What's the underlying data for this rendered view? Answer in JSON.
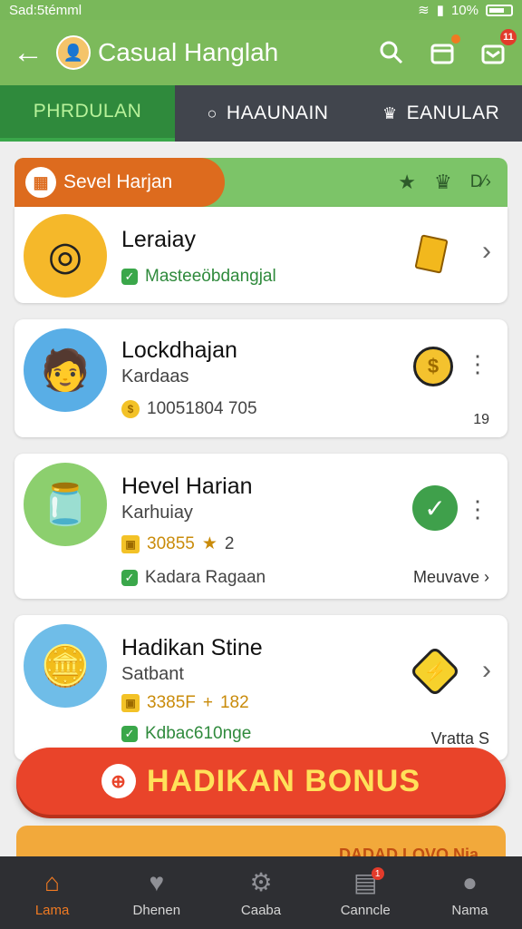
{
  "status_bar": {
    "left": "Sad:5témml",
    "battery": "10%"
  },
  "app_bar": {
    "title": "Casual Hanglah",
    "icons": [
      "back-arrow-icon",
      "search-icon",
      "calendar-icon",
      "gift-icon"
    ],
    "calendar_badge": "",
    "gift_badge": "11"
  },
  "tabs": [
    {
      "label": "PHRDULAN",
      "active": true
    },
    {
      "label": "HAAUNAIN",
      "icon": "search-bubble-icon"
    },
    {
      "label": "EANULAR",
      "icon": "trophy-icon"
    }
  ],
  "section": {
    "title": "Sevel Harjan",
    "more": "D⁄›",
    "colors": {
      "pill": "#dd6b1e",
      "band": "#7cc468"
    }
  },
  "items": [
    {
      "name": "Leraiay",
      "status": "Masteeöbdangjal",
      "thumb_icon": "target-clock-icon",
      "side_icon": "ticket-icon",
      "action": "chevron"
    },
    {
      "name": "Lockdhajan",
      "sub": "Kardaas",
      "coins": "10051804 705",
      "count": "19",
      "thumb_icon": "explorer-avatar-icon",
      "side_icon": "coin-icon",
      "action": "more"
    },
    {
      "name": "Hevel Harian",
      "sub": "Karhuiay",
      "reward": "30855",
      "reward_extra": "2",
      "status": "Kadara Ragaan",
      "right_link": "Meuvave",
      "thumb_icon": "jar-icon",
      "side_icon": "check-icon",
      "action": "more"
    },
    {
      "name": "Hadikan Stine",
      "sub": "Satbant",
      "reward": "3385F",
      "reward_extra": "182",
      "status": "Kdbac610nge",
      "right_text": "Vratta S",
      "thumb_icon": "treasure-chest-icon",
      "side_icon": "lightning-icon",
      "action": "chevron"
    }
  ],
  "bonus_button": {
    "label": "HADIKAN BONUS",
    "color": "#e9442a",
    "text_color": "#ffe15a"
  },
  "strip": {
    "text": "DADAD LOVO Nia"
  },
  "bottom_nav": [
    {
      "label": "Lama",
      "icon": "home-icon",
      "active": true
    },
    {
      "label": "Dhenen",
      "icon": "heart-chat-icon"
    },
    {
      "label": "Caaba",
      "icon": "gear-icon"
    },
    {
      "label": "Canncle",
      "icon": "card-icon",
      "badge": "1"
    },
    {
      "label": "Nama",
      "icon": "profile-icon"
    }
  ]
}
